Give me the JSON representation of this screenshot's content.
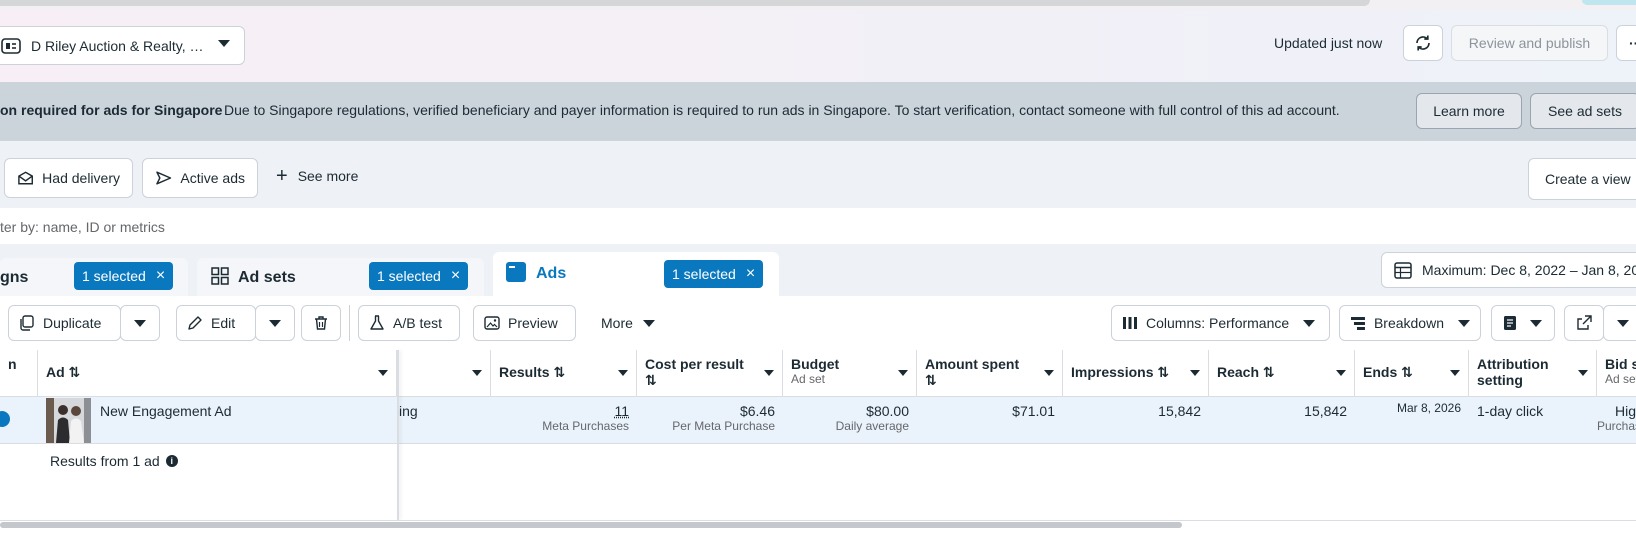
{
  "header": {
    "account_name": "D Riley Auction & Realty, …",
    "status": "Updated just now",
    "review_publish": "Review and publish",
    "more": "···"
  },
  "banner": {
    "title": "on required for ads for Singapore",
    "message": "Due to Singapore regulations, verified beneficiary and payer information is required to run ads in Singapore. To start verification, contact someone with full control of this ad account.",
    "learn_more": "Learn more",
    "see_ad_sets": "See ad sets"
  },
  "filters": {
    "chips": [
      "Had delivery",
      "Active ads"
    ],
    "see_more": "See more",
    "create_view": "Create a view",
    "search_placeholder": "ter by: name, ID or metrics"
  },
  "tabs": [
    {
      "label": "gns",
      "selected": "1 selected"
    },
    {
      "label": "Ad sets",
      "selected": "1 selected"
    },
    {
      "label": "Ads",
      "selected": "1 selected"
    }
  ],
  "date_range": "Maximum: Dec 8, 2022 – Jan 8, 20",
  "toolbar": {
    "duplicate": "Duplicate",
    "edit": "Edit",
    "ab_test": "A/B test",
    "preview": "Preview",
    "more": "More",
    "columns": "Columns: Performance",
    "breakdown": "Breakdown"
  },
  "table": {
    "headers": {
      "off": "n",
      "ad": "Ad ⇅",
      "results": "Results ⇅",
      "cost_per_result": "Cost per result",
      "cost_sort": "⇅",
      "budget": "Budget",
      "budget_sub": "Ad set",
      "amount_spent": "Amount spent",
      "amount_sort": "⇅",
      "impressions": "Impressions ⇅",
      "reach": "Reach ⇅",
      "ends": "Ends ⇅",
      "attribution": "Attribution",
      "attribution2": "setting",
      "bid": "Bid st",
      "bid_sub": "Ad set"
    },
    "row": {
      "ad_name": "New Engagement Ad",
      "delivery": "ing",
      "results": "11",
      "results_sub": "Meta Purchases",
      "cost": "$6.46",
      "cost_sub": "Per Meta Purchase",
      "budget": "$80.00",
      "budget_sub": "Daily average",
      "amount_spent": "$71.01",
      "impressions": "15,842",
      "reach": "15,842",
      "ends": "Mar 8, 2026",
      "attribution": "1-day click",
      "bid": "Hig",
      "bid_sub": "Purchas"
    },
    "summary": "Results from 1 ad"
  },
  "colors": {
    "accent": "#0a78be",
    "banner_bg": "#cbd3db",
    "row_selected": "#eaf3fb"
  }
}
